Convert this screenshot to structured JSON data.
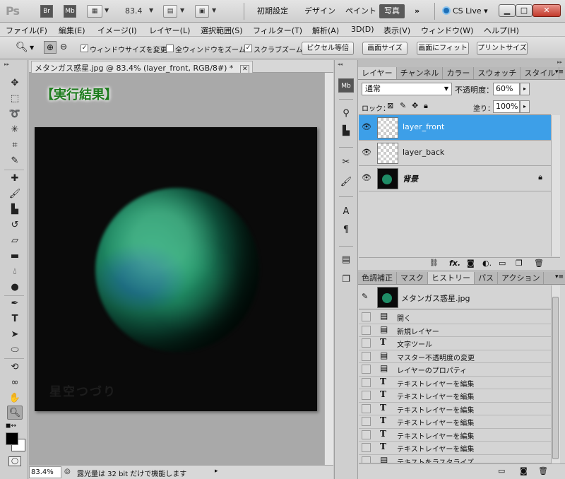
{
  "appbar": {
    "logo": "Ps",
    "bridge": "Br",
    "minibridge": "Mb",
    "zoom": "83.4",
    "workspaces": [
      "初期設定",
      "デザイン",
      "ペイント",
      "写真"
    ],
    "active_workspace": "写真",
    "more": "»",
    "cslive": "CS Live"
  },
  "menu": [
    "ファイル(F)",
    "編集(E)",
    "イメージ(I)",
    "レイヤー(L)",
    "選択範囲(S)",
    "フィルター(T)",
    "解析(A)",
    "3D(D)",
    "表示(V)",
    "ウィンドウ(W)",
    "ヘルプ(H)"
  ],
  "options": {
    "resize_windows": "ウィンドウサイズを変更",
    "zoom_all": "全ウィンドウをズーム",
    "scrubby_zoom": "スクラブズーム",
    "btn_actual": "ピクセル等倍",
    "btn_screen": "画面サイズ",
    "btn_fit": "画面にフィット",
    "btn_print": "プリントサイズ"
  },
  "document": {
    "tab_title": "メタンガス惑星.jpg @ 83.4% (layer_front, RGB/8#) *",
    "result_label": "【実行結果】",
    "watermark": "星空つづり",
    "zoom_status": "83.4%",
    "status_text": "露光量は 32 bit だけで機能します"
  },
  "layers_panel": {
    "tabs": [
      "レイヤー",
      "チャンネル",
      "カラー",
      "スウォッチ",
      "スタイル"
    ],
    "blend_mode": "通常",
    "opacity_label": "不透明度：",
    "opacity": "60%",
    "lock_label": "ロック：",
    "fill_label": "塗り：",
    "fill": "100%",
    "layers": [
      {
        "name": "layer_front"
      },
      {
        "name": "layer_back"
      },
      {
        "name": "背景"
      }
    ]
  },
  "history_panel": {
    "tabs": [
      "色調補正",
      "マスク",
      "ヒストリー",
      "パス",
      "アクション"
    ],
    "snapshot": "メタンガス惑星.jpg",
    "items": [
      "開く",
      "新規レイヤー",
      "文字ツール",
      "マスター不透明度の変更",
      "レイヤーのプロパティ",
      "テキストレイヤーを編集",
      "テキストレイヤーを編集",
      "テキストレイヤーを編集",
      "テキストレイヤーを編集",
      "テキストレイヤーを編集",
      "テキストレイヤーを編集",
      "テキストをラスタライズ"
    ]
  },
  "colors": {
    "accent": "#3d9fe8",
    "result_label": "#1e7c1e"
  }
}
